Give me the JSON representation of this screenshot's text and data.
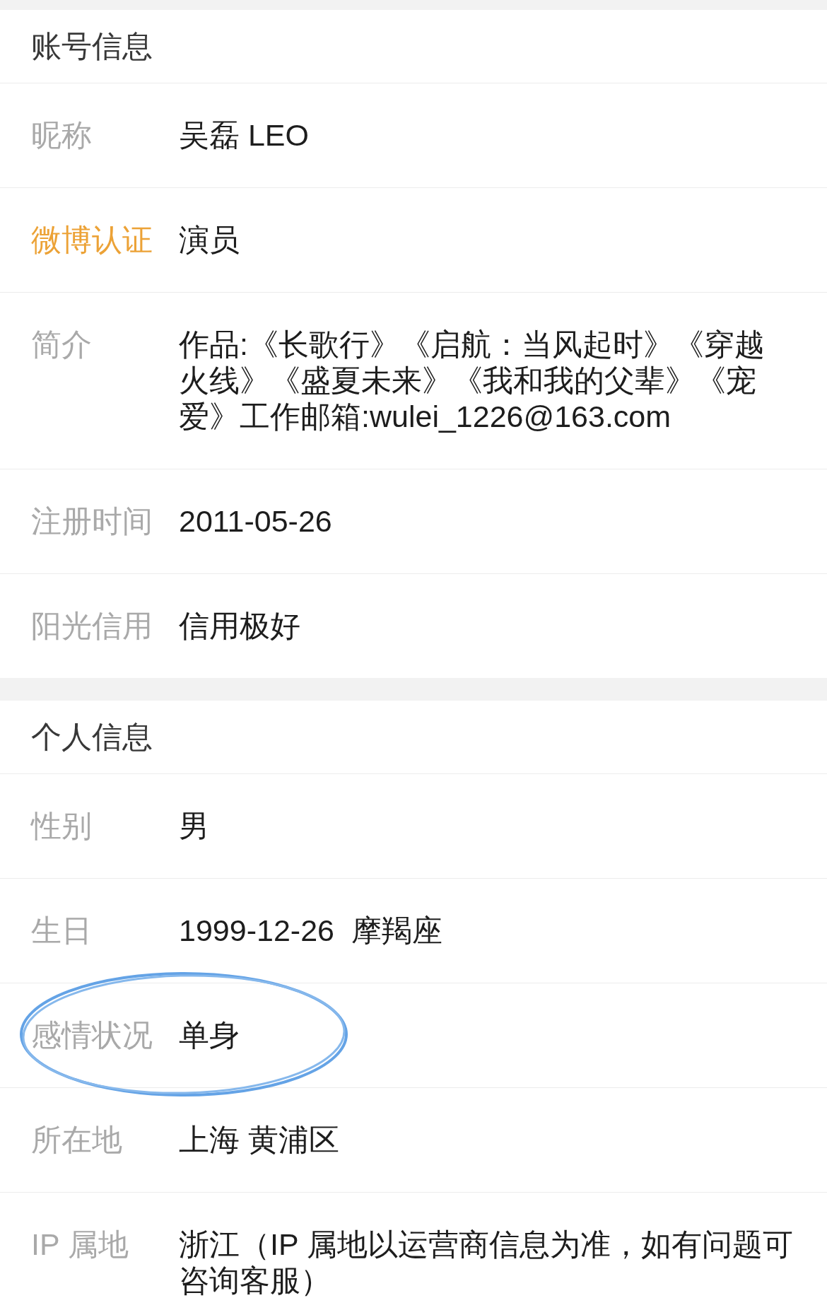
{
  "sections": [
    {
      "title": "账号信息",
      "rows": [
        {
          "label": "昵称",
          "value": "吴磊 LEO",
          "highlighted": false,
          "circled": false
        },
        {
          "label": "微博认证",
          "value": "演员",
          "highlighted": true,
          "circled": false
        },
        {
          "label": "简介",
          "value": "作品:《长歌行》《启航：当风起时》《穿越火线》《盛夏未来》《我和我的父辈》《宠爱》工作邮箱:wulei_1226@163.com",
          "highlighted": false,
          "circled": false
        },
        {
          "label": "注册时间",
          "value": "2011-05-26",
          "highlighted": false,
          "circled": false
        },
        {
          "label": "阳光信用",
          "value": "信用极好",
          "highlighted": false,
          "circled": false
        }
      ]
    },
    {
      "title": "个人信息",
      "rows": [
        {
          "label": "性别",
          "value": "男",
          "highlighted": false,
          "circled": false
        },
        {
          "label": "生日",
          "value": "1999-12-26  摩羯座",
          "highlighted": false,
          "circled": false
        },
        {
          "label": "感情状况",
          "value": "单身",
          "highlighted": false,
          "circled": true
        },
        {
          "label": "所在地",
          "value": "上海 黄浦区",
          "highlighted": false,
          "circled": false
        },
        {
          "label": "IP 属地",
          "value": "浙江（IP 属地以运营商信息为准，如有问题可咨询客服）",
          "highlighted": false,
          "circled": false
        }
      ]
    }
  ]
}
